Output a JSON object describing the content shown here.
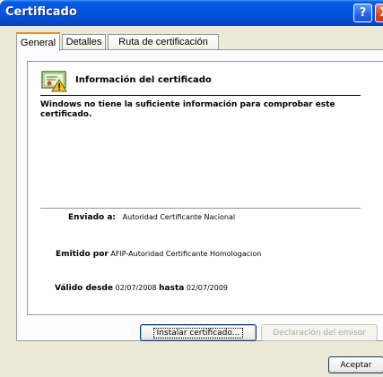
{
  "window": {
    "title": "Certificado",
    "help_label": "?",
    "close_label": "X"
  },
  "tabs": [
    {
      "label": "General",
      "active": true
    },
    {
      "label": "Detalles",
      "active": false
    },
    {
      "label": "Ruta de certificación",
      "active": false
    }
  ],
  "certificate": {
    "icon": "certificate-warning-icon",
    "heading": "Información del certificado",
    "warning": "Windows no tiene la suficiente información para comprobar este certificado.",
    "sent_to_label": "Enviado a:",
    "sent_to_value": "Autoridad Certificante Nacional",
    "issued_by_label": "Emitido por",
    "issued_by_value": "AFIP-Autoridad Certificante Homologacion",
    "valid_from_label": "Válido desde",
    "valid_from_value": "02/07/2008",
    "valid_to_label": "hasta",
    "valid_to_value": "02/07/2009"
  },
  "buttons": {
    "install": "Instalar certificado...",
    "issuer_statement": "Declaración del emisor",
    "accept": "Aceptar"
  },
  "colors": {
    "titlebar": "#0454E3",
    "window_bg": "#ECE9D8",
    "active_tab_accent": "#E68B2C",
    "disabled_text": "#ACA899"
  }
}
